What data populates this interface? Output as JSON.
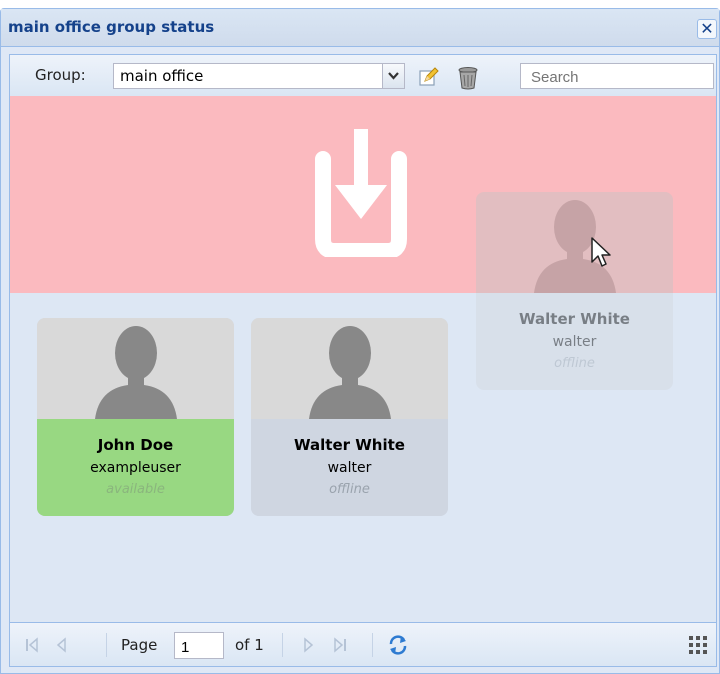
{
  "window": {
    "title": "main office group status",
    "close_label": "✕"
  },
  "toolbar": {
    "group_label": "Group:",
    "group_value": "main office",
    "search_placeholder": "Search"
  },
  "cards": [
    {
      "name": "John Doe",
      "username": "exampleuser",
      "status": "available",
      "status_color": "#98d882"
    },
    {
      "name": "Walter White",
      "username": "walter",
      "status": "offline",
      "status_color": "#cfd6e1"
    }
  ],
  "dragging_card": {
    "name": "Walter White",
    "username": "walter",
    "status": "offline"
  },
  "drop_zone": {
    "color": "#fbbabf",
    "icon": "drop-into-icon"
  },
  "pager": {
    "page_label": "Page",
    "page_value": "1",
    "of_label": "of 1"
  },
  "colors": {
    "title": "#15428b",
    "border": "#99bbe8",
    "available": "#98d882",
    "offline": "#cfd6e1"
  }
}
